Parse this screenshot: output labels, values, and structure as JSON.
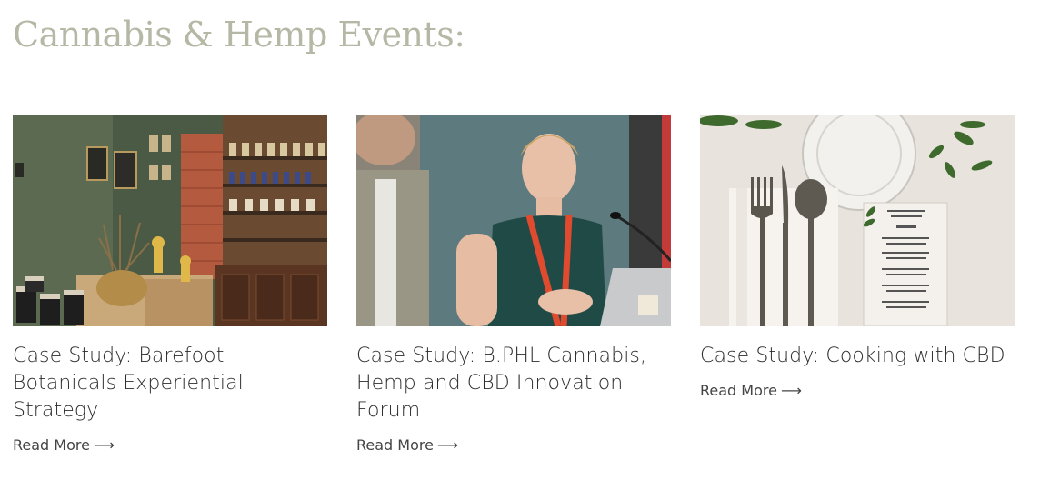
{
  "page": {
    "heading": "Cannabis & Hemp Events:"
  },
  "cards": [
    {
      "title": "Case Study: Barefoot Botanicals Experiential Strategy",
      "read_more": "Read More",
      "arrow": "⟶",
      "image_alt": "Barefoot Botanicals shop interior with shelves of jars and candles"
    },
    {
      "title": "Case Study: B.PHL Cannabis, Hemp and CBD Innovation Forum",
      "read_more": "Read More",
      "arrow": "⟶",
      "image_alt": "Speaker presenting at a podium with laptop and microphone"
    },
    {
      "title": "Case Study: Cooking with CBD",
      "read_more": "Read More",
      "arrow": "⟶",
      "image_alt": "Table setting with cutlery, glass and menu card"
    }
  ],
  "colors": {
    "heading": "#b6b8a6",
    "title": "#2d2d2d",
    "link": "#444444"
  }
}
